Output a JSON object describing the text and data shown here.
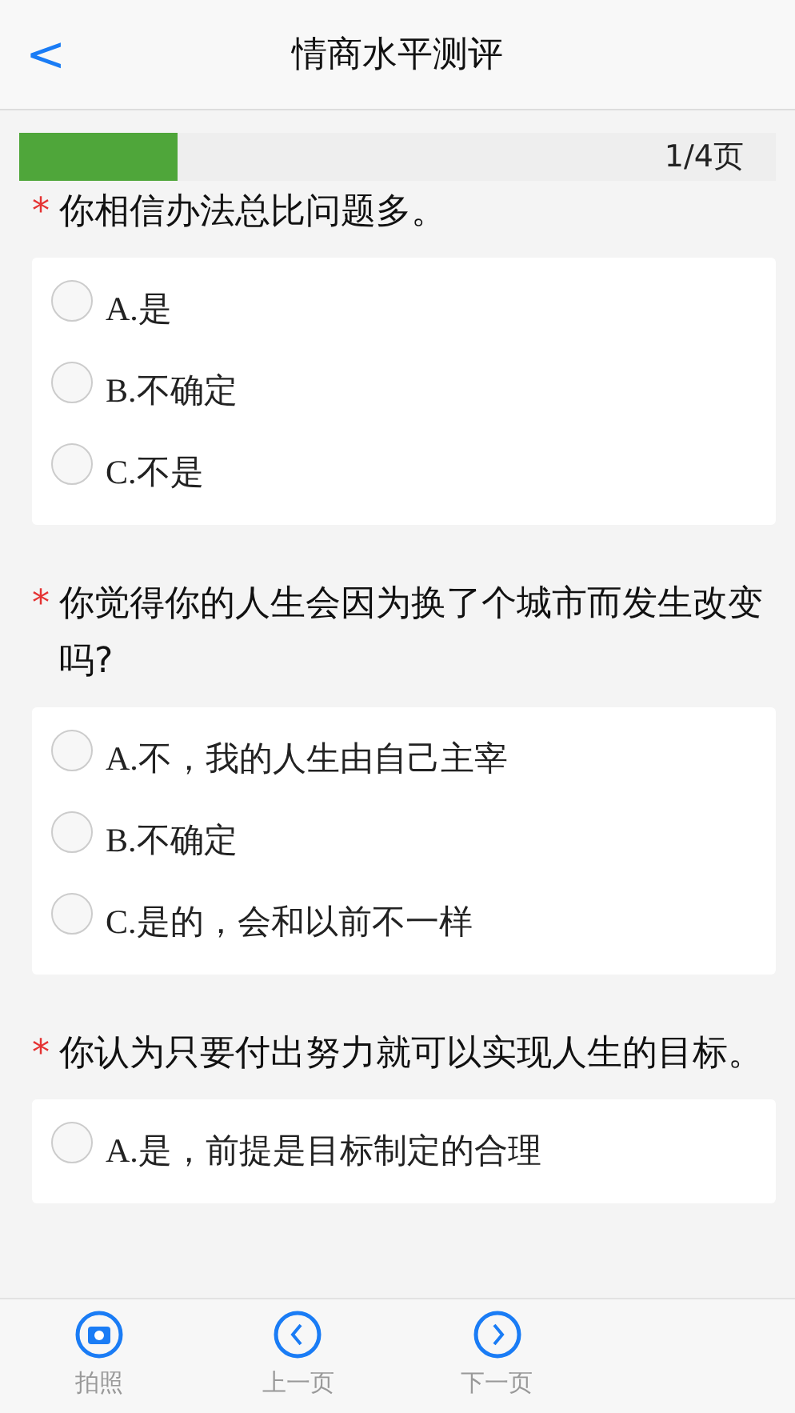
{
  "header": {
    "back": "<",
    "title": "情商水平测评"
  },
  "progress": {
    "level": 0.21,
    "label": "1/4页"
  },
  "questions": [
    {
      "marker": "*",
      "text": "你相信办法总比问题多。",
      "options": [
        {
          "label": "A.是",
          "selected": false
        },
        {
          "label": "B.不确定",
          "selected": false
        },
        {
          "label": "C.不是",
          "selected": false
        }
      ]
    },
    {
      "marker": "*",
      "text": "你觉得你的人生会因为换了个城市而发生改变吗?",
      "options": [
        {
          "label": "A.不，我的人生由自己主宰",
          "selected": false
        },
        {
          "label": "B.不确定",
          "selected": false
        },
        {
          "label": "C.是的，会和以前不一样",
          "selected": false
        }
      ]
    },
    {
      "marker": "*",
      "text": "你认为只要付出努力就可以实现人生的目标。",
      "options": [
        {
          "label": "A.是，前提是目标制定的合理",
          "selected": false
        }
      ]
    }
  ],
  "toolbar": [
    {
      "kind": "camera",
      "label": "拍照"
    },
    {
      "kind": "prev",
      "label": "上一页"
    },
    {
      "kind": "next",
      "label": "下一页"
    }
  ]
}
